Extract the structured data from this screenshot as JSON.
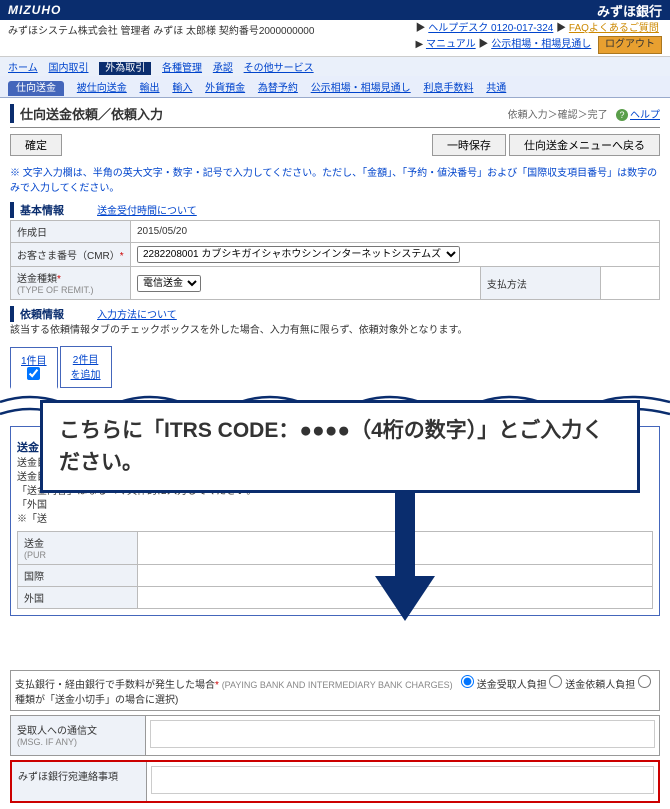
{
  "brand_left": "MIZUHO",
  "brand_right": "みずほ銀行",
  "company_line": "みずほシステム株式会社 管理者 みずほ 太郎様 契約番号2000000000",
  "help": {
    "desk": "ヘルプデスク 0120-017-324",
    "faq": "FAQよくあるご質問",
    "manual": "マニュアル",
    "notice": "公示相場・相場見通し"
  },
  "logout": "ログアウト",
  "nav1": {
    "home": "ホーム",
    "domestic": "国内取引",
    "fx": "外為取引",
    "mgmt": "各種管理",
    "accept": "承認",
    "other": "その他サービス"
  },
  "nav2": {
    "send": "仕向送金",
    "recv": "被仕向送金",
    "exp": "輸出",
    "imp": "輸入",
    "fdep": "外貨預金",
    "yoyaku": "為替予約",
    "rate": "公示相場・相場見通し",
    "fee": "利息手数料",
    "common": "共通"
  },
  "page": {
    "title": "仕向送金依頼／依頼入力",
    "crumb": "依頼入力＞確認＞完了",
    "help": "ヘルプ"
  },
  "buttons": {
    "confirm": "確定",
    "tempsave": "一時保存",
    "back": "仕向送金メニューへ戻る"
  },
  "note": "※ 文字入力欄は、半角の英大文字・数字・記号で入力してください。ただし、「金額」、「予約・値決番号」および「国際収支項目番号」は数字のみで入力してください。",
  "basic": {
    "heading": "基本情報",
    "link": "送金受付時間について",
    "date_l": "作成日",
    "date_v": "2015/05/20",
    "cust_l": "お客さま番号（CMR）",
    "cust_v": "2282208001 カブシキガイシャホウシンインターネットシステムズ",
    "type_l": "送金種類",
    "type_sub": "(TYPE OF REMIT.)",
    "type_v": "電信送金",
    "pay_l": "支払方法"
  },
  "req": {
    "heading": "依頼情報",
    "link": "入力方法について",
    "desc": "該当する依頼情報タブのチェックボックスを外した場合、入力有無に限らず、依頼対象外となります。",
    "tab1": "1件目",
    "tab2a": "2件目",
    "tab2b": "を追加"
  },
  "purpose": {
    "heading": "送金目的・許可等",
    "d1": "送金目的が「輸入」・「居住者間送金」の場合は国際収支項目番号の入力が不要です。",
    "d2": "送金目的が二つ以上に該当する場合は、みずほ銀行宛連絡事項欄に、送金内容を入力してください。",
    "d3": "「送金内容」はなるべく具体的に入力してください。",
    "l1": "「外国",
    "l2": "※「送",
    "row1": "送金",
    "row1s": "(PUR",
    "row2": "国際",
    "row3": "外国"
  },
  "callout": "こちらに「ITRS CODE：●●●●（4桁の数字）」とご入力ください。",
  "charges": {
    "label": "支払銀行・経由銀行で手数料が発生した場合",
    "sub": "(PAYING BANK AND INTERMEDIARY BANK CHARGES)",
    "o1": "送金受取人負担",
    "o2": "送金依頼人負担",
    "o3": "種類が「送金小切手」の場合に選択)"
  },
  "msg": {
    "label": "受取人への通信文",
    "sub": "(MSG. IF ANY)"
  },
  "mizuho": {
    "label": "みずほ銀行宛連絡事項"
  }
}
